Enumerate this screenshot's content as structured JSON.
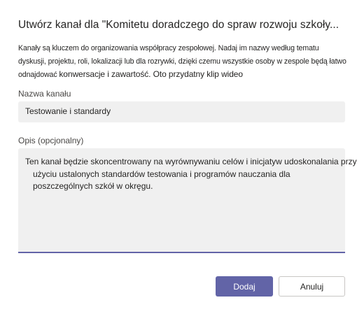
{
  "dialog": {
    "title": "Utwórz kanał dla \"Komitetu doradczego do spraw rozwoju szkoły...",
    "description": "Kanały są kluczem do organizowania współpracy zespołowej. Nadaj im nazwy według tematu dyskusji, projektu, roli, lokalizacji lub dla rozrywki, dzięki czemu wszystkie osoby w zespole będą łatwo odnajdować",
    "description_last": "konwersacje i zawartość. Oto przydatny klip wideo"
  },
  "form": {
    "name_label": "Nazwa kanału",
    "name_value": "Testowanie i standardy",
    "description_label": "Opis (opcjonalny)",
    "description_line1": "Ten kanał będzie skoncentrowany na wyrównywaniu celów i inicjatyw udoskonalania przy",
    "description_rest": "użyciu ustalonych standardów testowania i programów nauczania dla poszczególnych szkół w okręgu."
  },
  "buttons": {
    "add_label": "Dodaj",
    "cancel_label": "Anuluj"
  },
  "colors": {
    "accent": "#6264a7",
    "field_bg": "#f0f0f0"
  }
}
